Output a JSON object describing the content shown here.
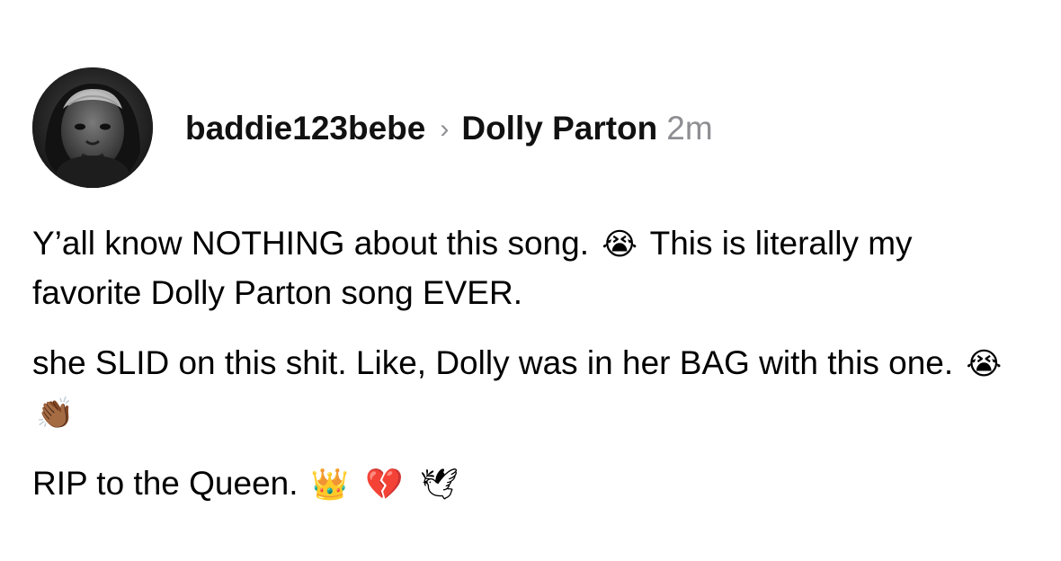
{
  "post": {
    "author": "baddie123bebe",
    "separator_icon": "chevron-right-icon",
    "separator_glyph": "›",
    "target_page": "Dolly Parton",
    "time": "2m",
    "paragraphs": [
      {
        "text_1": "Y’all know NOTHING about this song.",
        "emoji_1": "😭",
        "text_2": "This is literally my favorite Dolly Parton song EVER."
      },
      {
        "text_1": " she SLID on this shit. Like, Dolly was in her BAG with this one.",
        "emoji_1": "😭",
        "emoji_2": "👏🏾"
      },
      {
        "text_1": "RIP to the Queen.",
        "emoji_1": "👑",
        "emoji_2": "💔",
        "emoji_3": "🕊"
      }
    ]
  }
}
